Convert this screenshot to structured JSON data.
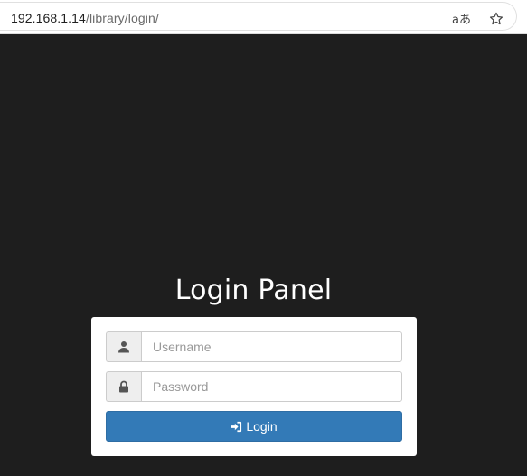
{
  "browser": {
    "url_host": "192.168.1.14",
    "url_path": "/library/login/",
    "translate_icon": "translate-icon",
    "bookmark_icon": "star-outline-icon"
  },
  "login": {
    "title": "Login Panel",
    "username_placeholder": "Username",
    "username_value": "",
    "password_placeholder": "Password",
    "password_value": "",
    "username_icon": "user-icon",
    "password_icon": "lock-icon",
    "button_icon": "sign-in-icon",
    "button_label": "Login"
  },
  "colors": {
    "page_background": "#1e1e1e",
    "panel_background": "#ffffff",
    "button_primary": "#337ab7",
    "addon_background": "#eeeeee"
  }
}
